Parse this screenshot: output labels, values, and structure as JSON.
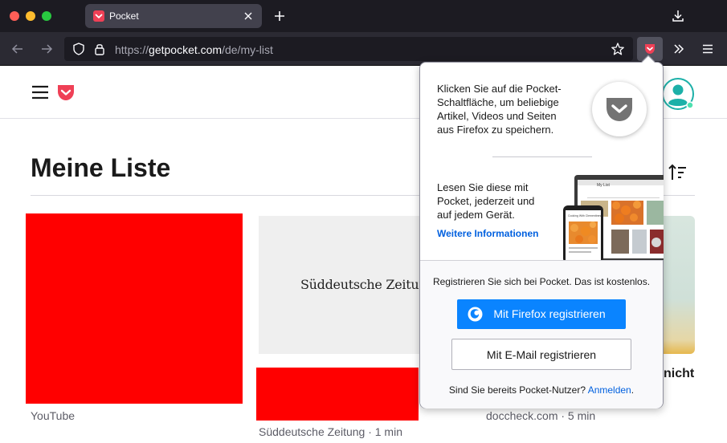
{
  "browser": {
    "tab_title": "Pocket",
    "url_prefix": "https://",
    "url_host": "getpocket.com",
    "url_path": "/de/my-list"
  },
  "page": {
    "title": "Meine Liste",
    "cards": [
      {
        "meta": "YouTube"
      },
      {
        "logo_text": "Süddeutsche Zeitung",
        "meta": "Süddeutsche Zeitung · 1 min"
      },
      {
        "title_fragment": "nicht",
        "meta": "doccheck.com · 5 min"
      }
    ]
  },
  "panel": {
    "intro": "Klicken Sie auf die Pocket-Schaltfläche, um beliebige Artikel, Videos und Seiten aus Firefox zu speichern.",
    "read_anywhere": "Lesen Sie diese mit Pocket, jederzeit und auf jedem Gerät.",
    "more_info_link": "Weitere Informationen",
    "register_prompt": "Registrieren Sie sich bei Pocket. Das ist kostenlos.",
    "firefox_button": "Mit Firefox registrieren",
    "email_button": "Mit E-Mail registrieren",
    "signin_prompt": "Sind Sie bereits Pocket-Nutzer?",
    "signin_link": "Anmelden",
    "signin_suffix": ".",
    "devices_mock": {
      "list_heading": "My List",
      "phone_caption": "Cooking With Clementines"
    }
  },
  "colors": {
    "pocket_red": "#ef4056",
    "link_blue": "#0060df",
    "firefox_button_blue": "#0a84ff",
    "chrome_dark": "#1c1b22",
    "placeholder_red": "#ff0000"
  }
}
